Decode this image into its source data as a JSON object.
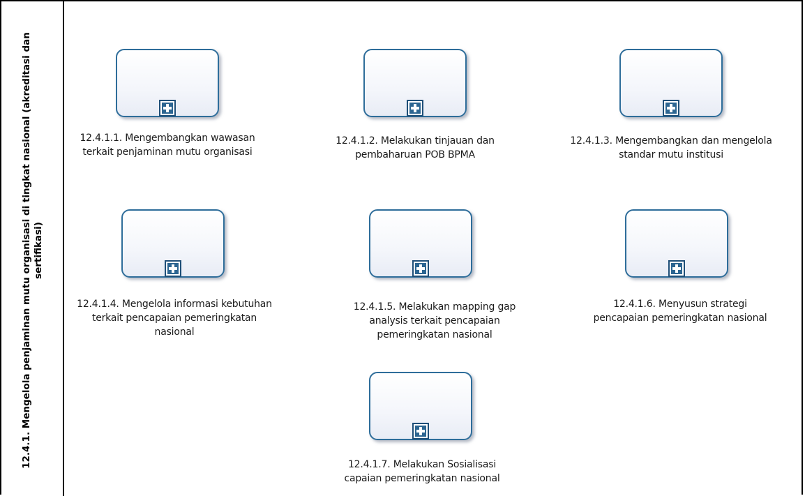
{
  "lane": {
    "title": "12.4.1. Mengelola penjaminan mutu organisasi di tingkat nasional (akreditasi dan sertifikasi)"
  },
  "tasks": [
    {
      "label": "12.4.1.1. Mengembangkan wawasan terkait penjaminan mutu organisasi"
    },
    {
      "label": "12.4.1.2. Melakukan tinjauan dan pembaharuan POB BPMA"
    },
    {
      "label": "12.4.1.3. Mengembangkan dan mengelola standar mutu institusi"
    },
    {
      "label": "12.4.1.4. Mengelola informasi kebutuhan terkait pencapaian pemeringkatan nasional"
    },
    {
      "label": "12.4.1.5. Melakukan mapping gap analysis terkait pencapaian pemeringkatan nasional"
    },
    {
      "label": "12.4.1.6. Menyusun strategi pencapaian pemeringkatan nasional"
    },
    {
      "label": "12.4.1.7. Melakukan Sosialisasi capaian pemeringkatan nasional"
    }
  ],
  "icons": {
    "subprocess_marker": "plus-square-icon"
  }
}
